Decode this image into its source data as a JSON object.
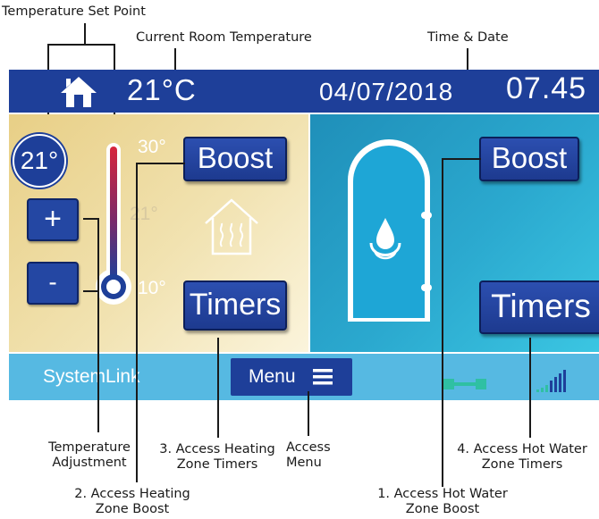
{
  "annotations": {
    "temperature_set_point": "Temperature Set Point",
    "current_room_temperature": "Current Room Temperature",
    "time_date": "Time & Date",
    "temperature_adjustment_line1": "Temperature",
    "temperature_adjustment_line2": "Adjustment",
    "heating_timers_line1": "3. Access Heating",
    "heating_timers_line2": "Zone Timers",
    "access_menu_line1": "Access",
    "access_menu_line2": "Menu",
    "water_timers_line1": "4. Access Hot Water",
    "water_timers_line2": "Zone Timers",
    "heating_boost_line1": "2. Access Heating",
    "heating_boost_line2": "Zone Boost",
    "water_boost_line1": "1. Access Hot Water",
    "water_boost_line2": "Zone Boost"
  },
  "header": {
    "room_temperature": "21°C",
    "date": "04/07/2018",
    "time": "07.45",
    "home_icon": "home-icon"
  },
  "heating": {
    "set_point": "21°",
    "plus_label": "+",
    "minus_label": "-",
    "thermo_max": "30°",
    "thermo_mid": "21°",
    "thermo_min": "10°",
    "boost_label": "Boost",
    "timers_label": "Timers",
    "zone_icon": "house-heating-icon"
  },
  "hot_water": {
    "boost_label": "Boost",
    "timers_label": "Timers",
    "zone_icon": "water-cylinder-icon"
  },
  "footer": {
    "brand": "SystemLink",
    "menu_label": "Menu",
    "menu_icon": "hamburger-icon",
    "link_icon": "connection-link-icon",
    "signal_icon": "signal-strength-icon"
  },
  "colors": {
    "header_bg": "#1e3f99",
    "footer_bg": "#56b9e2",
    "button_bg": "#2447a3",
    "thermo_red": "#d7263d",
    "water_panel": "#2ba9cf",
    "heating_panel": "#f1e2b0"
  }
}
